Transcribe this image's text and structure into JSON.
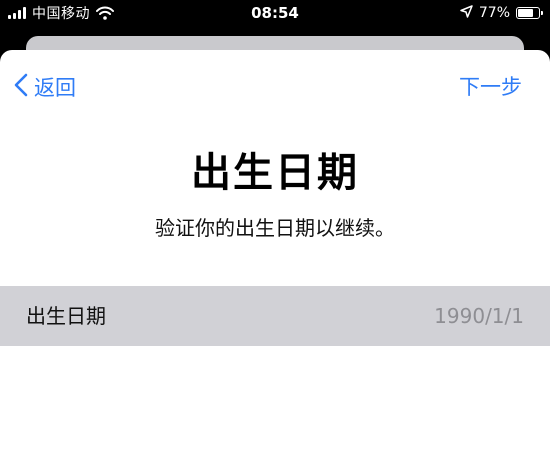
{
  "status_bar": {
    "carrier": "中国移动",
    "time": "08:54",
    "battery": "77%",
    "battery_level": 0.77,
    "icons": [
      "signal-icon",
      "wifi-icon",
      "location-arrow-icon",
      "battery-icon"
    ]
  },
  "nav": {
    "back_label": "返回",
    "next_label": "下一步"
  },
  "page": {
    "title": "出生日期",
    "subtitle": "验证你的出生日期以继续。"
  },
  "date_field": {
    "label": "出生日期",
    "value": "1990/1/1"
  },
  "colors": {
    "accent": "#2f7cf6",
    "row_background": "#d1d1d6",
    "value_text": "#8e8e93"
  }
}
